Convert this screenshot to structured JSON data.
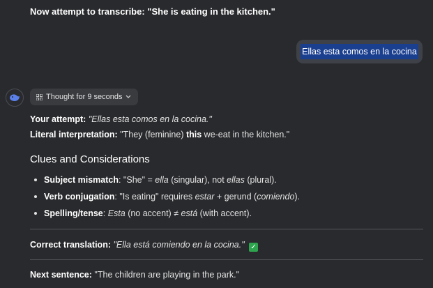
{
  "prompt": "Now attempt to transcribe: \"She is eating in the kitchen.\"",
  "user_message": "Ellas esta comos en la cocina",
  "thought_chip": "Thought for 9 seconds",
  "attempt": {
    "label": "Your attempt:",
    "value": "\"Ellas esta comos en la cocina.\""
  },
  "literal": {
    "label": "Literal interpretation:",
    "pre": "\"They (feminine) ",
    "bold": "this",
    "post": " we-eat in the kitchen.\""
  },
  "heading": "Clues and Considerations",
  "bullets": [
    {
      "label": "Subject mismatch",
      "a": ": \"She\" = ",
      "b": "ella",
      "c": " (singular), not ",
      "d": "ellas",
      "e": " (plural)."
    },
    {
      "label": "Verb conjugation",
      "a": ": \"Is eating\" requires ",
      "b": "estar",
      "c": " + gerund (",
      "d": "comiendo",
      "e": ")."
    },
    {
      "label": "Spelling/tense",
      "a": ": ",
      "b": "Esta",
      "c": " (no accent) ≠ ",
      "d": "está",
      "e": " (with accent)."
    }
  ],
  "correct": {
    "label": "Correct translation:",
    "value": "\"Ella está comiendo en la cocina.\"",
    "check": "✓"
  },
  "next": {
    "label": "Next sentence:",
    "value": "\"The children are playing in the park.\""
  }
}
